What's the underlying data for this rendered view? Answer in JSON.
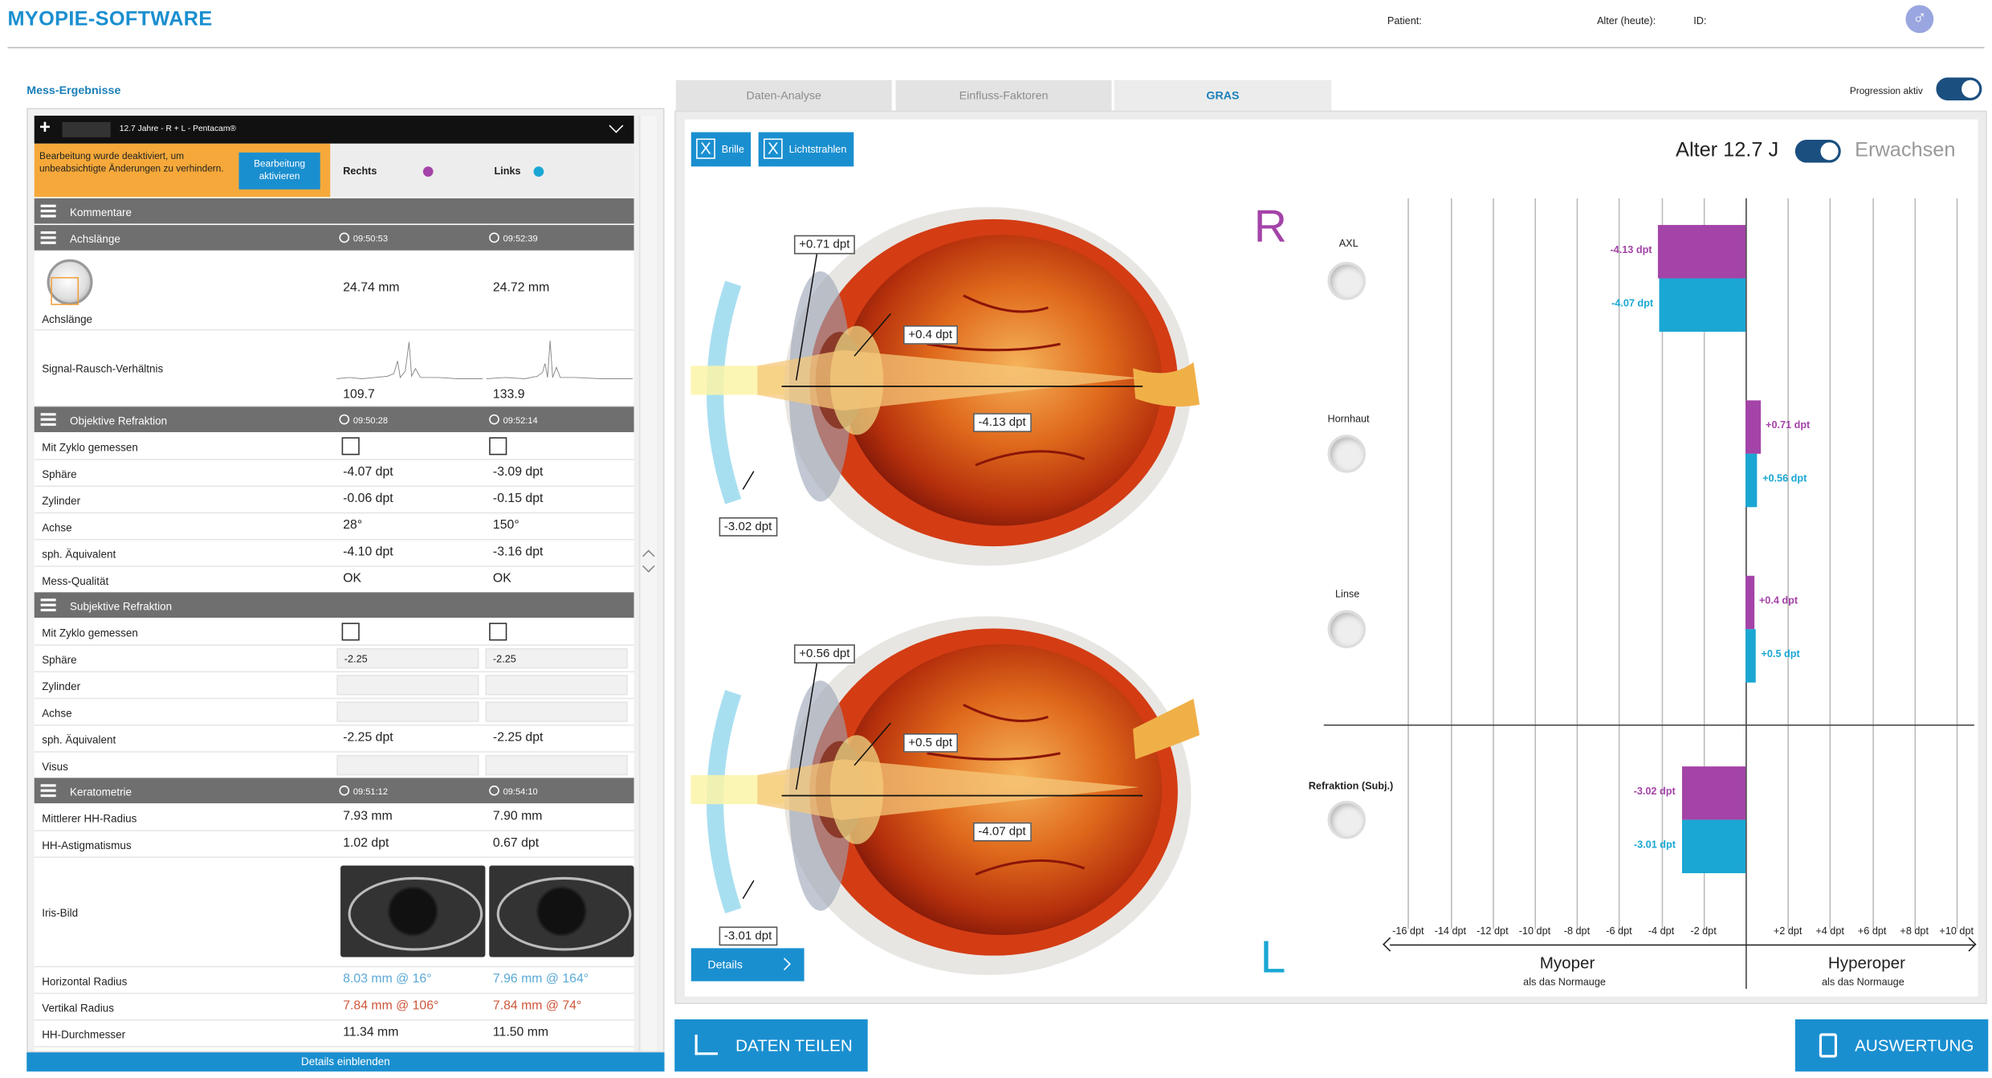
{
  "header": {
    "title": "MYOPIE-SOFTWARE",
    "patient_label": "Patient:",
    "age_label": "Alter (heute):",
    "id_label": "ID:",
    "gender_symbol": "♂"
  },
  "left": {
    "section_title": "Mess-Ergebnisse",
    "exam_bar": {
      "plus": "+",
      "info": "12.7 Jahre  -  R + L  -  Pentacam®"
    },
    "warning": {
      "text": "Bearbeitung wurde deaktiviert, um unbeabsichtigte Änderungen zu verhindern.",
      "button": "Bearbeitung aktivieren"
    },
    "col_right": "Rechts",
    "col_left": "Links",
    "groups": {
      "kommentare": "Kommentare",
      "achslaenge": {
        "label": "Achslänge",
        "t1": "09:50:53",
        "t2": "09:52:39"
      },
      "objektiv": {
        "label": "Objektive Refraktion",
        "t1": "09:50:28",
        "t2": "09:52:14"
      },
      "subjektiv": {
        "label": "Subjektive Refraktion"
      },
      "kerato": {
        "label": "Keratometrie",
        "t1": "09:51:12",
        "t2": "09:54:10"
      }
    },
    "achslaenge": {
      "label": "Achslänge",
      "r": "24.74 mm",
      "l": "24.72 mm"
    },
    "snr": {
      "label": "Signal-Rausch-Verhältnis",
      "r": "109.7",
      "l": "133.9"
    },
    "obj": [
      {
        "label": "Mit Zyklo gemessen"
      },
      {
        "label": "Sphäre",
        "r": "-4.07 dpt",
        "l": "-3.09 dpt"
      },
      {
        "label": "Zylinder",
        "r": "-0.06 dpt",
        "l": "-0.15 dpt"
      },
      {
        "label": "Achse",
        "r": "28°",
        "l": "150°"
      },
      {
        "label": "sph. Äquivalent",
        "r": "-4.10 dpt",
        "l": "-3.16 dpt"
      },
      {
        "label": "Mess-Qualität",
        "r": "OK",
        "l": "OK"
      }
    ],
    "subj": [
      {
        "label": "Mit Zyklo gemessen"
      },
      {
        "label": "Sphäre",
        "r": "-2.25",
        "l": "-2.25"
      },
      {
        "label": "Zylinder"
      },
      {
        "label": "Achse"
      },
      {
        "label": "sph. Äquivalent",
        "r": "-2.25 dpt",
        "l": "-2.25 dpt"
      },
      {
        "label": "Visus"
      }
    ],
    "kera": [
      {
        "label": "Mittlerer HH-Radius",
        "r": "7.93 mm",
        "l": "7.90 mm"
      },
      {
        "label": "HH-Astigmatismus",
        "r": "1.02 dpt",
        "l": "0.67 dpt"
      }
    ],
    "iris_label": "Iris-Bild",
    "kera2": [
      {
        "label": "Horizontal Radius",
        "r": "8.03 mm @ 16°",
        "l": "7.96 mm @ 164°"
      },
      {
        "label": "Vertikal Radius",
        "r": "7.84 mm @ 106°",
        "l": "7.84 mm @ 74°"
      },
      {
        "label": "HH-Durchmesser",
        "r": "11.34 mm",
        "l": "11.50 mm"
      }
    ],
    "details_btn": "Details einblenden"
  },
  "tabs": [
    {
      "label": "Daten-Analyse"
    },
    {
      "label": "Einfluss-Faktoren"
    },
    {
      "label": "GRAS"
    }
  ],
  "progression_label": "Progression aktiv",
  "mid": {
    "brille": "Brille",
    "licht": "Lichtstrahlen",
    "x": "X",
    "age": "Alter 12.7 J",
    "adult": "Erwachsen",
    "R": "R",
    "L": "L",
    "eyeR": {
      "cornea": "+0.71 dpt",
      "lens": "+0.4 dpt",
      "axl": "-4.13 dpt",
      "refr": "-3.02 dpt"
    },
    "eyeL": {
      "cornea": "+0.56 dpt",
      "lens": "+0.5 dpt",
      "axl": "-4.07 dpt",
      "refr": "-3.01 dpt"
    },
    "details": "Details",
    "myoper": "Myoper",
    "hyperoper": "Hyperoper",
    "sub": "als das Normauge"
  },
  "chart_data": {
    "type": "bar",
    "orientation": "horizontal",
    "categories": [
      "AXL",
      "Hornhaut",
      "Linse",
      "Refraktion (Subj.)"
    ],
    "series": [
      {
        "values": [
          -4.13,
          0.71,
          0.4,
          -3.02
        ],
        "labels": [
          "-4.13 dpt",
          "+0.71 dpt",
          "+0.4 dpt",
          "-3.02 dpt"
        ],
        "color": "#a443a8"
      },
      {
        "values": [
          -4.07,
          0.56,
          0.5,
          -3.01
        ],
        "labels": [
          "-4.07 dpt",
          "+0.56 dpt",
          "+0.5 dpt",
          "-3.01 dpt"
        ],
        "color": "#1aa7d3"
      }
    ],
    "xlim": [
      -16,
      11
    ],
    "ticks": [
      -16,
      -14,
      -12,
      -10,
      -8,
      -6,
      -4,
      -2,
      2,
      4,
      6,
      8,
      10
    ],
    "tick_labels": [
      "-16 dpt",
      "-14 dpt",
      "-12 dpt",
      "-10 dpt",
      "-8 dpt",
      "-6 dpt",
      "-4 dpt",
      "-2 dpt",
      "+2 dpt",
      "+4 dpt",
      "+6 dpt",
      "+8 dpt",
      "+10 dpt"
    ]
  },
  "bottom": {
    "share": "DATEN TEILEN",
    "eval": "AUSWERTUNG"
  }
}
